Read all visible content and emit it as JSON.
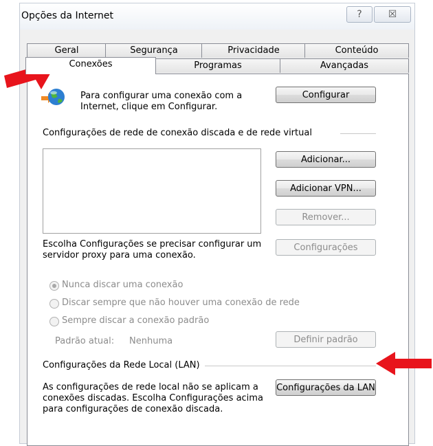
{
  "window": {
    "title": "Opções da Internet",
    "help_label": "?",
    "close_label": "☒"
  },
  "tabs": {
    "row1": [
      "Geral",
      "Segurança",
      "Privacidade",
      "Conteúdo"
    ],
    "row2": [
      "Conexões",
      "Programas",
      "Avançadas"
    ],
    "active": "Conexões"
  },
  "setup": {
    "text_line1": "Para configurar uma conexão com a",
    "text_line2": "Internet, clique em Configurar.",
    "button": "Configurar",
    "icon": "globe-network-icon"
  },
  "dialup": {
    "heading": "Configurações de rede de conexão discada e de rede virtual",
    "buttons": {
      "add": "Adicionar...",
      "add_vpn": "Adicionar VPN...",
      "remove": "Remover...",
      "settings": "Configurações"
    },
    "proxy_text_line1": "Escolha Configurações se precisar configurar um",
    "proxy_text_line2": "servidor proxy para uma conexão.",
    "options": [
      {
        "label": "Nunca discar uma conexão",
        "selected": true
      },
      {
        "label": "Discar sempre que não houver uma conexão de rede",
        "selected": false
      },
      {
        "label": "Sempre discar a conexão padrão",
        "selected": false
      }
    ],
    "current_default_label": "Padrão atual:",
    "current_default_value": "Nenhuma",
    "set_default_button": "Definir padrão"
  },
  "lan": {
    "heading": "Configurações da Rede Local (LAN)",
    "text_line1": "As configurações de rede local não se aplicam a",
    "text_line2": "conexões discadas. Escolha Configurações acima",
    "text_line3": "para configurações de conexão discada.",
    "button": "Configurações da LAN"
  },
  "annotation_color": "#e8141c"
}
